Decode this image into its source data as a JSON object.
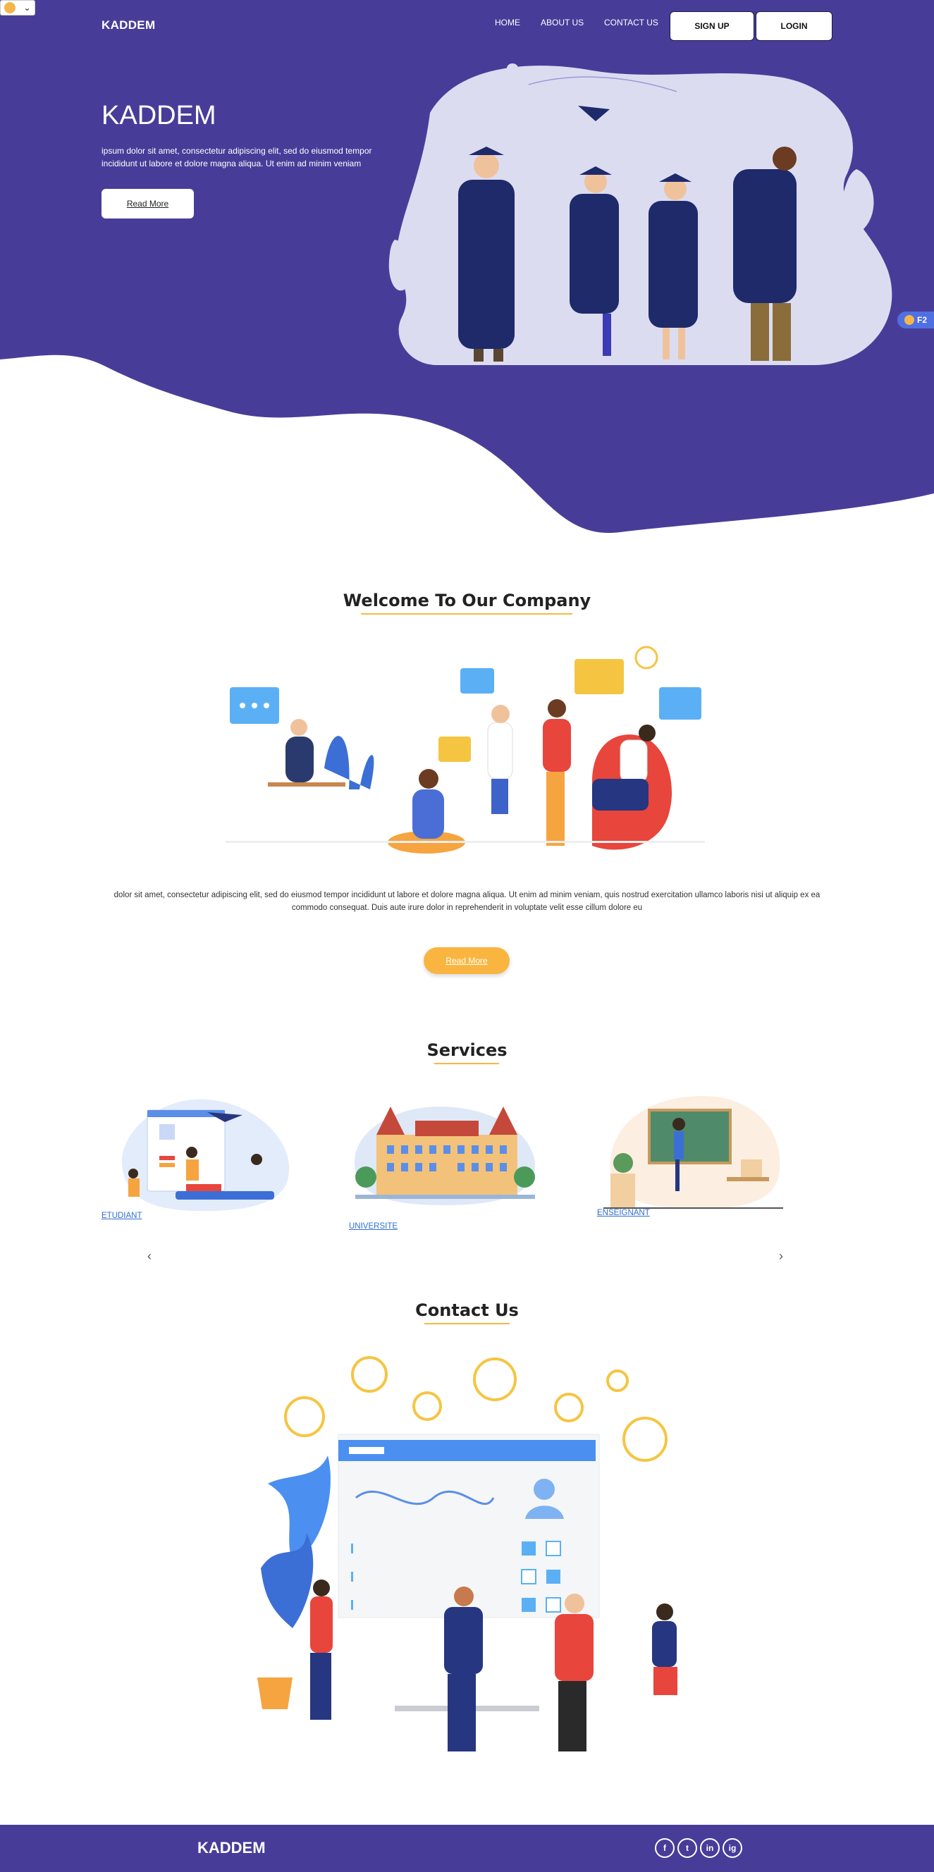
{
  "brand": "KADDEM",
  "nav": {
    "home": "HOME",
    "about": "ABOUT US",
    "contact": "CONTACT US",
    "signup": "SIGN UP",
    "login": "LOGIN"
  },
  "hero": {
    "title": "KADDEM",
    "text": "ipsum dolor sit amet, consectetur adipiscing elit, sed do eiusmod tempor incididunt ut labore et dolore magna aliqua. Ut enim ad minim veniam",
    "button": "Read More"
  },
  "badge": {
    "label": "F2"
  },
  "welcome": {
    "title": "Welcome To Our Company",
    "text": "dolor sit amet, consectetur adipiscing elit, sed do eiusmod tempor incididunt ut labore et dolore magna aliqua. Ut enim ad minim veniam, quis nostrud exercitation ullamco laboris nisi ut aliquip ex ea commodo consequat. Duis aute irure dolor in reprehenderit in voluptate velit esse cillum dolore eu",
    "button": "Read More"
  },
  "services": {
    "title": "Services",
    "items": [
      {
        "label": "ETUDIANT"
      },
      {
        "label": "UNIVERSITE"
      },
      {
        "label": "ENSEIGNANT"
      }
    ],
    "prev": "‹",
    "next": "›"
  },
  "contact": {
    "title": "Contact Us"
  },
  "footer": {
    "brand": "KADDEM",
    "social": [
      "f",
      "t",
      "in",
      "ig"
    ]
  },
  "colors": {
    "primary": "#473d99",
    "accent": "#f9b53f",
    "link": "#2f6fd0"
  },
  "icons": [
    "chevron-down-icon",
    "facebook-icon",
    "twitter-icon",
    "linkedin-icon",
    "instagram-icon",
    "chevron-left-icon",
    "chevron-right-icon"
  ]
}
